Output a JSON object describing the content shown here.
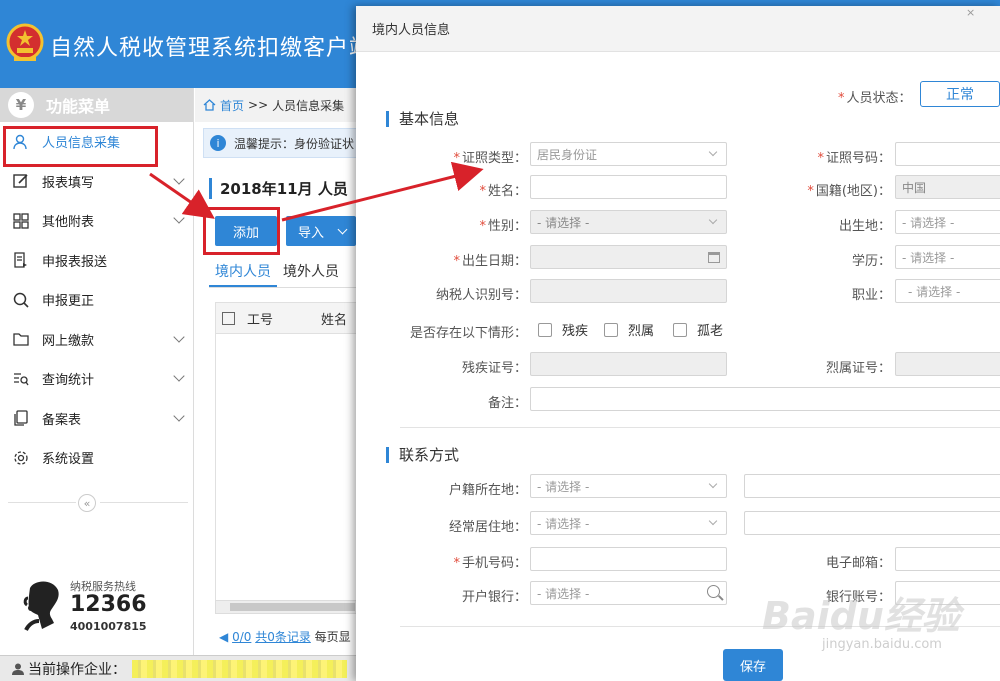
{
  "app": {
    "title": "自然人税收管理系统扣缴客户端"
  },
  "sidebar": {
    "header": "功能菜单",
    "items": [
      {
        "label": "人员信息采集",
        "icon": "person-icon",
        "expandable": false
      },
      {
        "label": "报表填写",
        "icon": "edit-icon",
        "expandable": true
      },
      {
        "label": "其他附表",
        "icon": "grid-icon",
        "expandable": true
      },
      {
        "label": "申报表报送",
        "icon": "send-report-icon",
        "expandable": false
      },
      {
        "label": "申报更正",
        "icon": "search-icon",
        "expandable": false
      },
      {
        "label": "网上缴款",
        "icon": "folder-icon",
        "expandable": true
      },
      {
        "label": "查询统计",
        "icon": "list-search-icon",
        "expandable": true
      },
      {
        "label": "备案表",
        "icon": "copy-icon",
        "expandable": true
      },
      {
        "label": "系统设置",
        "icon": "gear-icon",
        "expandable": false
      }
    ],
    "collapse_symbol": "«",
    "hotline": {
      "label": "纳税服务热线",
      "number": "12366",
      "alt_number": "4001007815"
    }
  },
  "statusbar": {
    "label": "当前操作企业："
  },
  "main": {
    "breadcrumb": {
      "home": "首页",
      "sep": ">>",
      "current": "人员信息采集"
    },
    "notice": "温馨提示：身份验证状",
    "period": "2018年11月  人员",
    "buttons": {
      "add": "添加",
      "import": "导入"
    },
    "tabs": [
      "境内人员",
      "境外人员"
    ],
    "table": {
      "columns": [
        "工号",
        "姓名"
      ]
    },
    "pager": {
      "count_link": "0/0",
      "records": "共0条记录",
      "per_page": "每页显"
    }
  },
  "dialog": {
    "title": "境内人员信息",
    "close": "×",
    "status": {
      "label": "人员状态：",
      "value": "正常"
    },
    "basic_section": "基本信息",
    "fields": {
      "id_type": {
        "label": "证照类型：",
        "value": "居民身份证"
      },
      "id_number": {
        "label": "证照号码：",
        "value": ""
      },
      "name": {
        "label": "姓名：",
        "value": ""
      },
      "nationality": {
        "label": "国籍(地区)：",
        "value": "中国"
      },
      "gender": {
        "label": "性别：",
        "value": "- 请选择 -"
      },
      "birthplace": {
        "label": "出生地：",
        "value": "- 请选择 -"
      },
      "birth_date": {
        "label": "出生日期：",
        "value": ""
      },
      "education": {
        "label": "学历：",
        "value": "- 请选择 -"
      },
      "taxpayer_id": {
        "label": "纳税人识别号：",
        "value": ""
      },
      "occupation": {
        "label": "职业：",
        "value": "- 请选择 -"
      },
      "situations_label": "是否存在以下情形：",
      "situations": [
        "残疾",
        "烈属",
        "孤老"
      ],
      "disability_cert": {
        "label": "残疾证号：",
        "value": ""
      },
      "martyr_cert": {
        "label": "烈属证号：",
        "value": ""
      },
      "remark": {
        "label": "备注：",
        "value": ""
      }
    },
    "contact_section": "联系方式",
    "contact": {
      "household": {
        "label": "户籍所在地：",
        "value": "- 请选择 -"
      },
      "residence": {
        "label": "经常居住地：",
        "value": "- 请选择 -"
      },
      "mobile": {
        "label": "手机号码：",
        "value": ""
      },
      "email": {
        "label": "电子邮箱：",
        "value": ""
      },
      "bank": {
        "label": "开户银行：",
        "value": "- 请选择 -"
      },
      "bank_account": {
        "label": "银行账号：",
        "value": ""
      }
    },
    "save": "保存"
  },
  "watermark": {
    "main": "Baidu经验",
    "sub": "jingyan.baidu.com"
  },
  "colors": {
    "brand_blue": "#2f86d6",
    "annotation_red": "#d8222a",
    "required": "#e14b3b"
  }
}
